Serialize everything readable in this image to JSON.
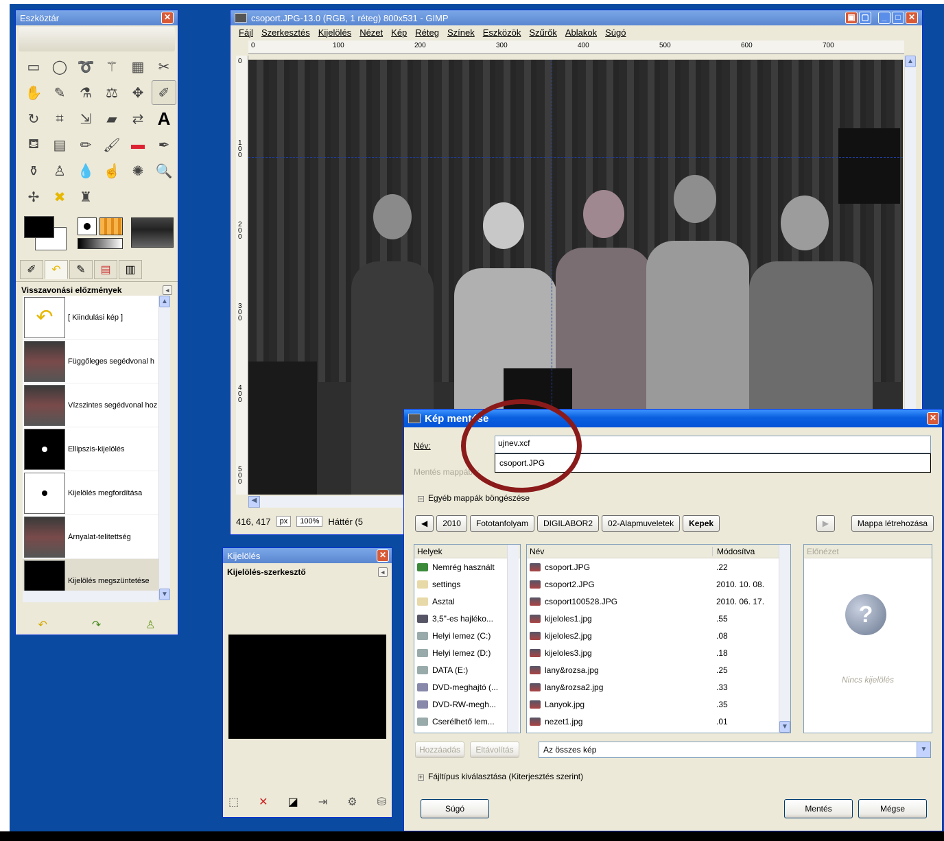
{
  "toolbox": {
    "title": "Eszköztár",
    "history_title": "Visszavonási előzmények",
    "history": [
      {
        "label": "[ Kiindulási kép ]",
        "icon": "undo-arrow-icon"
      },
      {
        "label": "Függőleges segédvonal h",
        "icon": "photo-thumb"
      },
      {
        "label": "Vízszintes segédvonal hoz",
        "icon": "photo-thumb"
      },
      {
        "label": "Ellipszis-kijelölés",
        "icon": "mask-dot"
      },
      {
        "label": "Kijelölés megfordítása",
        "icon": "mask-dot-inverted"
      },
      {
        "label": "Árnyalat-telítettség",
        "icon": "photo-thumb"
      },
      {
        "label": "Kijelölés megszüntetése",
        "icon": "black-thumb"
      }
    ]
  },
  "image_window": {
    "title": "csoport.JPG-13.0 (RGB, 1 réteg) 800x531 - GIMP",
    "menu": [
      "Fájl",
      "Szerkesztés",
      "Kijelölés",
      "Nézet",
      "Kép",
      "Réteg",
      "Színek",
      "Eszközök",
      "Szűrők",
      "Ablakok",
      "Súgó"
    ],
    "ruler_top": [
      "0",
      "100",
      "200",
      "300",
      "400",
      "500",
      "600",
      "700"
    ],
    "ruler_left": [
      "0",
      "100",
      "200",
      "300",
      "400",
      "500"
    ],
    "status": {
      "coords": "416, 417",
      "unit": "px",
      "zoom": "100%",
      "layer": "Háttér (5"
    }
  },
  "selection_editor": {
    "title": "Kijelölés",
    "panel_title": "Kijelölés-szerkesztő"
  },
  "save_dialog": {
    "title": "Kép mentése",
    "name_label": "Név:",
    "name_value": "ujnev.xcf",
    "completion": "csoport.JPG",
    "folder_label": "Mentés mappába:",
    "folder_value": "Kepek",
    "browse_label": "Egyéb mappák böngészése",
    "path": [
      "2010",
      "Fototanfolyam",
      "DIGILABOR2",
      "02-Alapmuveletek",
      "Kepek"
    ],
    "new_folder": "Mappa létrehozása",
    "places_header": "Helyek",
    "places": [
      {
        "label": "Nemrég használt",
        "icon": "recent-icon"
      },
      {
        "label": "settings",
        "icon": "folder-icon"
      },
      {
        "label": "Asztal",
        "icon": "folder-icon"
      },
      {
        "label": "3,5\"-es hajléko...",
        "icon": "floppy-icon"
      },
      {
        "label": "Helyi lemez (C:)",
        "icon": "drive-icon"
      },
      {
        "label": "Helyi lemez (D:)",
        "icon": "drive-icon"
      },
      {
        "label": "DATA (E:)",
        "icon": "drive-icon"
      },
      {
        "label": "DVD-meghajtó (...",
        "icon": "dvd-icon"
      },
      {
        "label": "DVD-RW-megh...",
        "icon": "dvd-icon"
      },
      {
        "label": "Cserélhető lem...",
        "icon": "drive-icon"
      }
    ],
    "files_header_name": "Név",
    "files_header_modified": "Módosítva",
    "files": [
      {
        "name": "csoport.JPG",
        "modified": ".22"
      },
      {
        "name": "csoport2.JPG",
        "modified": "2010. 10. 08."
      },
      {
        "name": "csoport100528.JPG",
        "modified": "2010. 06. 17."
      },
      {
        "name": "kijeloles1.jpg",
        "modified": ".55"
      },
      {
        "name": "kijeloles2.jpg",
        "modified": ".08"
      },
      {
        "name": "kijeloles3.jpg",
        "modified": ".18"
      },
      {
        "name": "lany&rozsa.jpg",
        "modified": ".25"
      },
      {
        "name": "lany&rozsa2.jpg",
        "modified": ".33"
      },
      {
        "name": "Lanyok.jpg",
        "modified": ".35"
      },
      {
        "name": "nezet1.jpg",
        "modified": ".01"
      }
    ],
    "preview_header": "Előnézet",
    "preview_empty": "Nincs kijelölés",
    "add_button": "Hozzáadás",
    "remove_button": "Eltávolítás",
    "filter": "Az összes kép",
    "filetype_label": "Fájltípus kiválasztása (Kiterjesztés szerint)",
    "help_button": "Súgó",
    "save_button": "Mentés",
    "cancel_button": "Mégse"
  },
  "colors": {
    "annotation": "#8b1a1a",
    "desktop": "#0a4aa0",
    "xp_title": "#0a5fe0"
  }
}
